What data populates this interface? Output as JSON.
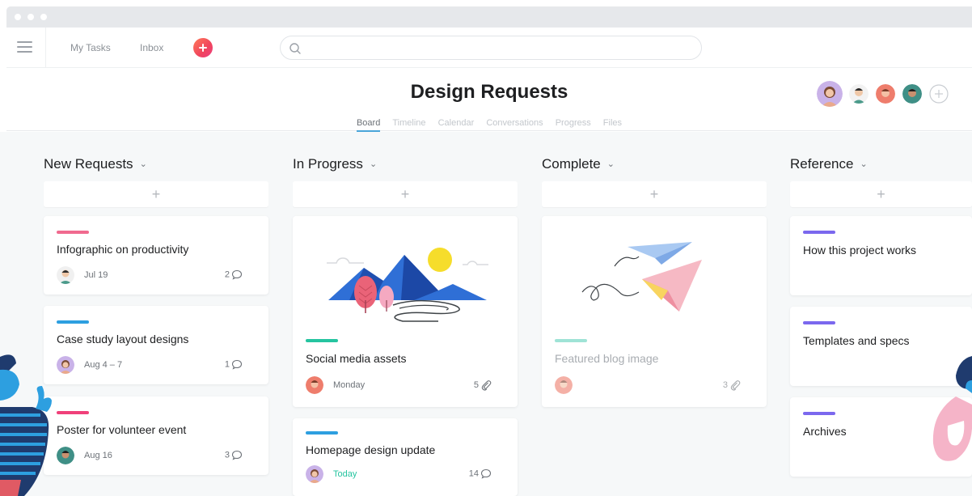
{
  "topbar": {
    "my_tasks": "My Tasks",
    "inbox": "Inbox",
    "search_placeholder": ""
  },
  "project": {
    "title": "Design Requests",
    "tabs": [
      {
        "label": "Board",
        "active": true
      },
      {
        "label": "Timeline",
        "active": false
      },
      {
        "label": "Calendar",
        "active": false
      },
      {
        "label": "Conversations",
        "active": false
      },
      {
        "label": "Progress",
        "active": false
      },
      {
        "label": "Files",
        "active": false
      }
    ]
  },
  "columns": [
    {
      "title": "New Requests",
      "add_label": "+",
      "cards": [
        {
          "tag_color": "#f06a8f",
          "name": "Infographic on productivity",
          "due": "Jul 19",
          "count": "2",
          "count_icon": "comment-icon"
        },
        {
          "tag_color": "#2d9fe0",
          "name": "Case study layout designs",
          "due": "Aug 4 – 7",
          "count": "1",
          "count_icon": "comment-icon"
        },
        {
          "tag_color": "#f0407a",
          "name": "Poster for volunteer event",
          "due": "Aug 16",
          "count": "3",
          "count_icon": "comment-icon"
        }
      ]
    },
    {
      "title": "In Progress",
      "add_label": "+",
      "cards": [
        {
          "tag_color": "#25c4a0",
          "name": "Social media assets",
          "due": "Monday",
          "count": "5",
          "count_icon": "attachment-icon"
        },
        {
          "tag_color": "#2d9fe0",
          "name": "Homepage design update",
          "due": "Today",
          "count": "14",
          "count_icon": "comment-icon"
        }
      ]
    },
    {
      "title": "Complete",
      "add_label": "+",
      "cards": [
        {
          "tag_color": "#9fe3d6",
          "name": "Featured blog image",
          "due": "",
          "count": "3",
          "count_icon": "attachment-icon"
        }
      ]
    },
    {
      "title": "Reference",
      "add_label": "+",
      "cards": [
        {
          "tag_color": "#7b68ee",
          "name": "How this project works"
        },
        {
          "tag_color": "#7b68ee",
          "name": "Templates and specs"
        },
        {
          "tag_color": "#7b68ee",
          "name": "Archives"
        }
      ]
    }
  ],
  "colors": {
    "accent": "#4aa5d9",
    "brand_add": "#f0445d",
    "today": "#25c4a0",
    "board_bg": "#f6f8f9"
  }
}
